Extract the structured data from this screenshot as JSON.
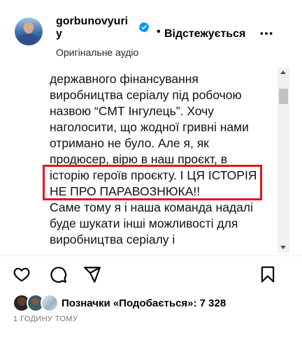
{
  "header": {
    "username_line1": "gorbunovyuri",
    "username_line2": "y",
    "follow_separator": "•",
    "follow_status": "Відстежується",
    "audio": "Оригінальне аудіо"
  },
  "caption": {
    "lines": [
      "державного фінансування",
      "виробництва серіалу під робочою",
      "назвою “СМТ Інгулець”. Хочу",
      "наголосити, що жодної гривні нами",
      "отримано не було. Але я, як",
      "продюсер, вірю в наш проєкт, в",
      "історію героїв проєкту. І ЦЯ ІСТОРІЯ",
      "НЕ ПРО ПАРАВОЗНЮКА!!",
      "Саме тому я і наша команда надалі",
      "буде шукати інші можливості для",
      "виробництва серіалу і"
    ]
  },
  "likes": {
    "label": "Позначки «Подобається»: 7 328"
  },
  "time_ago": "1 ГОДИНУ ТОМУ",
  "colors": {
    "highlight": "#e8121a",
    "verified": "#0095f6",
    "muted": "#737373"
  },
  "icons": {
    "like": "heart-icon",
    "comment": "comment-icon",
    "share": "send-icon",
    "save": "bookmark-icon",
    "more": "more-horizontal-icon"
  }
}
